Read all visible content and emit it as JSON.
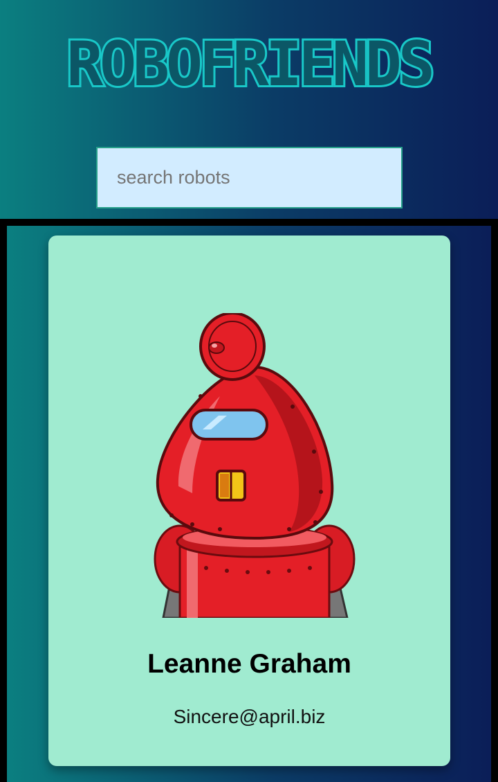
{
  "header": {
    "title": "ROBOFRIENDS"
  },
  "search": {
    "placeholder": "search robots",
    "value": ""
  },
  "robots": [
    {
      "name": "Leanne Graham",
      "email": "Sincere@april.biz",
      "image_icon": "red-robot-icon"
    }
  ],
  "colors": {
    "title_outline": "#19c8c8",
    "search_background": "#d2ecff",
    "card_background": "#a0ebd0",
    "gradient_start": "#0b7f80",
    "gradient_end": "#0b1e58"
  }
}
